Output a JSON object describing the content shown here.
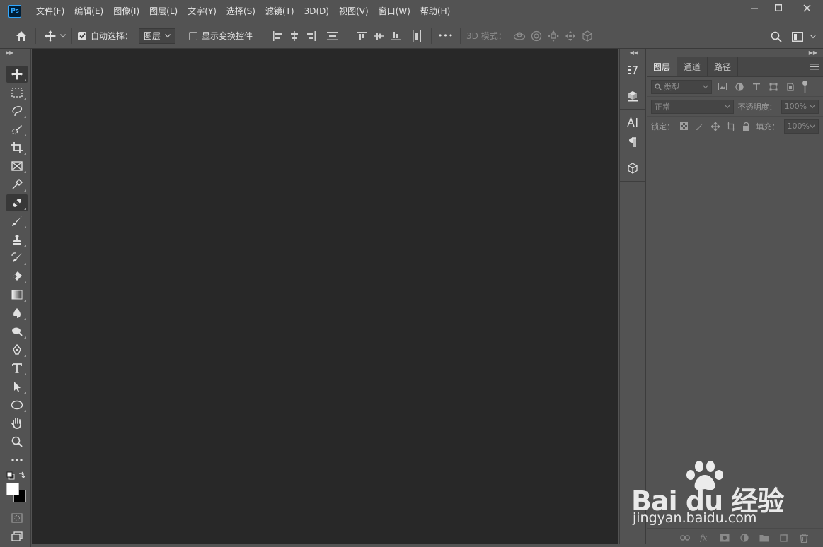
{
  "app": {
    "logo": "Ps"
  },
  "menu": [
    "文件(F)",
    "编辑(E)",
    "图像(I)",
    "图层(L)",
    "文字(Y)",
    "选择(S)",
    "滤镜(T)",
    "3D(D)",
    "视图(V)",
    "窗口(W)",
    "帮助(H)"
  ],
  "options": {
    "auto_select_label": "自动选择：",
    "auto_select_checked": true,
    "auto_select_target": "图层",
    "transform_controls_label": "显示变换控件",
    "more_label": "•••",
    "mode3d_label": "3D 模式："
  },
  "tools": [
    "move-tool-icon",
    "marquee-tool-icon",
    "lasso-tool-icon",
    "quick-select-tool-icon",
    "crop-tool-icon",
    "frame-tool-icon",
    "eyedropper-tool-icon",
    "healing-brush-tool-icon",
    "brush-tool-icon",
    "clone-stamp-tool-icon",
    "history-brush-tool-icon",
    "eraser-tool-icon",
    "gradient-tool-icon",
    "blur-tool-icon",
    "dodge-tool-icon",
    "pen-tool-icon",
    "type-tool-icon",
    "path-select-tool-icon",
    "ellipse-tool-icon",
    "hand-tool-icon",
    "zoom-tool-icon",
    "edit-toolbar-icon"
  ],
  "colors": {
    "foreground": "#ffffff",
    "background": "#000000"
  },
  "layers_panel": {
    "tabs": [
      "图层",
      "通道",
      "路径"
    ],
    "active_tab": "图层",
    "filter_kind": "类型",
    "blend_mode": "正常",
    "opacity_label": "不透明度：",
    "opacity_value": "100%",
    "lock_label": "锁定：",
    "fill_label": "填充：",
    "fill_value": "100%"
  },
  "watermark": {
    "brand": "Bai du 经验",
    "url": "jingyan.baidu.com"
  }
}
